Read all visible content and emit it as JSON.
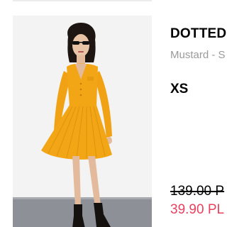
{
  "product": {
    "name": "DOTTED",
    "color": "Mustard - S",
    "size": "XS",
    "old_price": "139.00 P",
    "sale_price": "39.90 PL"
  },
  "colors": {
    "sale": "#e8405f",
    "dress": "#f2a615",
    "muted_text": "#9a9a9a"
  }
}
